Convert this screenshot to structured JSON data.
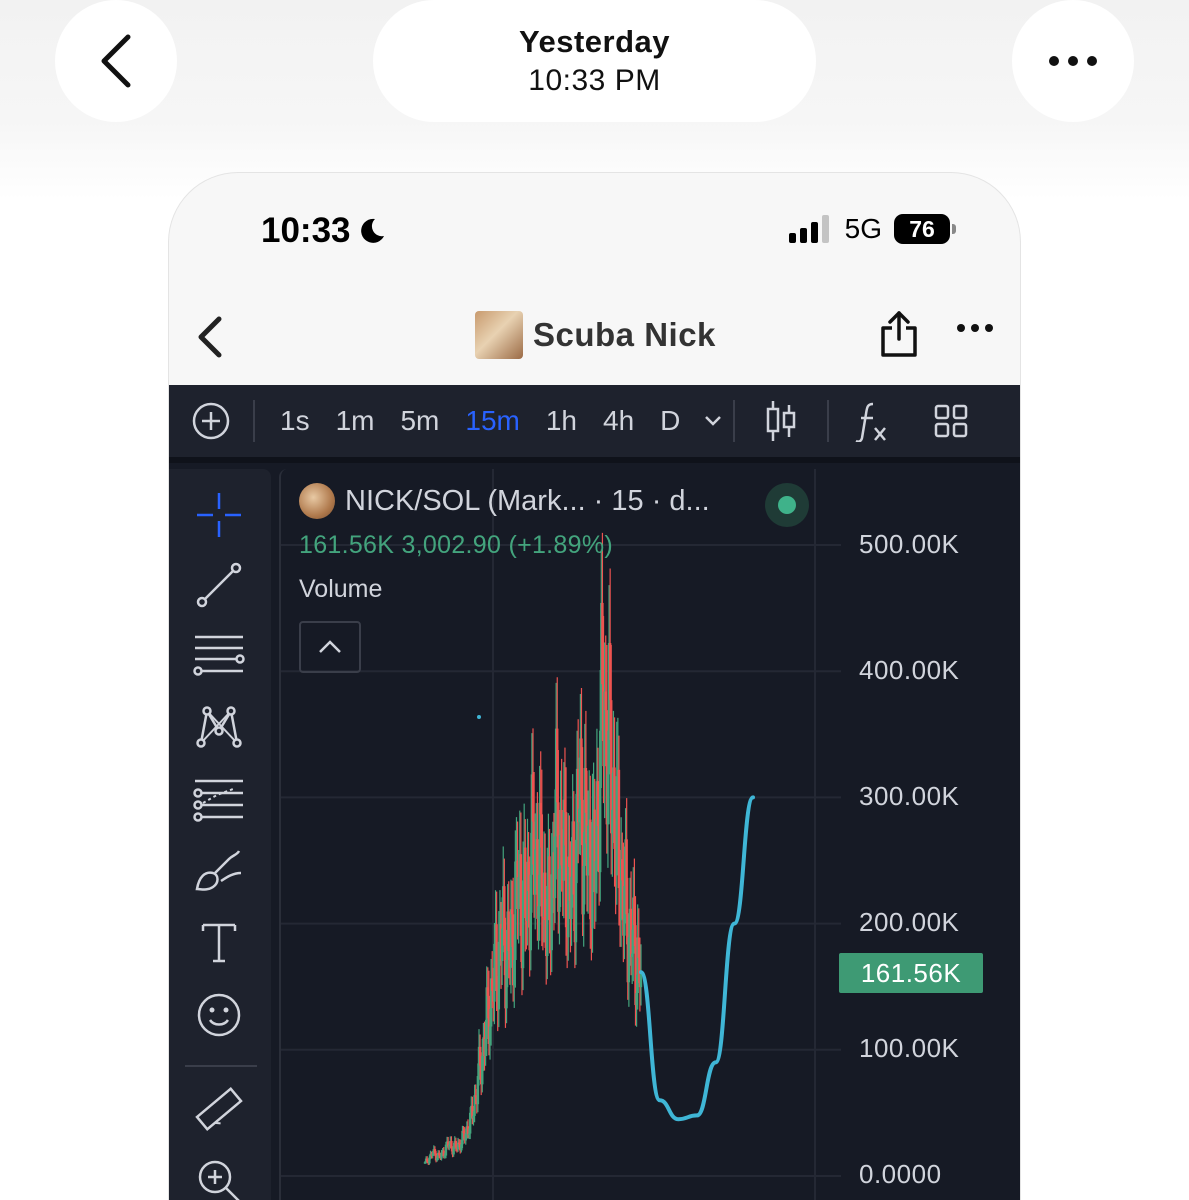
{
  "viewer": {
    "date_line": "Yesterday",
    "time_line": "10:33 PM"
  },
  "status_bar": {
    "time": "10:33",
    "network": "5G",
    "battery": "76"
  },
  "nav": {
    "title": "Scuba Nick"
  },
  "toolbar": {
    "timeframes": [
      "1s",
      "1m",
      "5m",
      "15m",
      "1h",
      "4h",
      "D"
    ],
    "active_timeframe": "15m"
  },
  "legend": {
    "symbol": "NICK/SOL (Mark... · 15 · d...",
    "ohlc_line": "161.56K  3,002.90 (+1.89%)",
    "indicator": "Volume"
  },
  "colors": {
    "up": "#43a47d",
    "down": "#ef5350",
    "drawing": "#3fb6d6",
    "active": "#2962ff",
    "background": "#161a25"
  },
  "chart_data": {
    "type": "line",
    "description_series": "candlestick price (approx close values per 15m bar)",
    "y_ticks": [
      "500.00K",
      "400.00K",
      "300.00K",
      "200.00K",
      "100.00K",
      "0.0000"
    ],
    "ylim": [
      0,
      500000
    ],
    "current_price_label": "161.56K",
    "current_price": 161560,
    "series": [
      {
        "values": [
          10000,
          18000,
          15000,
          25000,
          22000,
          30000,
          45000,
          80000,
          120000,
          160000,
          190000,
          175000,
          230000,
          210000,
          260000,
          240000,
          200000,
          280000,
          250000,
          220000,
          300000,
          260000,
          240000,
          380000,
          330000,
          260000,
          210000,
          180000,
          161560
        ]
      },
      {
        "values": [
          161560,
          60000,
          45000,
          48000,
          90000,
          200000,
          300000
        ]
      }
    ]
  }
}
